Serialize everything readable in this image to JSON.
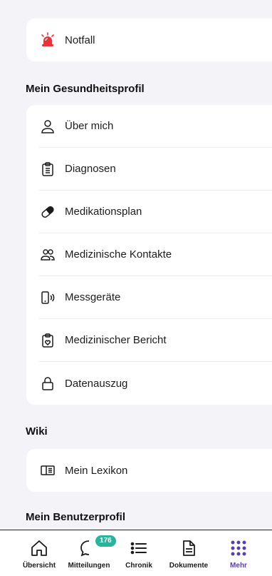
{
  "emergency": {
    "label": "Notfall",
    "icon": "alarm-siren-icon",
    "accent": "#e8333b"
  },
  "health_profile": {
    "title": "Mein Gesundheitsprofil",
    "items": [
      {
        "label": "Über mich",
        "icon": "person-icon"
      },
      {
        "label": "Diagnosen",
        "icon": "clipboard-icon"
      },
      {
        "label": "Medikationsplan",
        "icon": "pill-icon"
      },
      {
        "label": "Medizinische Kontakte",
        "icon": "people-icon"
      },
      {
        "label": "Messgeräte",
        "icon": "device-icon"
      },
      {
        "label": "Medizinischer Bericht",
        "icon": "report-icon"
      },
      {
        "label": "Datenauszug",
        "icon": "lock-icon"
      }
    ]
  },
  "wiki": {
    "title": "Wiki",
    "items": [
      {
        "label": "Mein Lexikon",
        "icon": "book-icon"
      }
    ]
  },
  "user_profile": {
    "title": "Mein Benutzerprofil"
  },
  "tabbar": {
    "active_color": "#5b3fa8",
    "badge_color": "#2bb39b",
    "tabs": [
      {
        "label": "Übersicht",
        "icon": "home-icon"
      },
      {
        "label": "Mitteilungen",
        "icon": "chat-icon",
        "badge": "176"
      },
      {
        "label": "Chronik",
        "icon": "list-icon"
      },
      {
        "label": "Dokumente",
        "icon": "document-icon"
      },
      {
        "label": "Mehr",
        "icon": "grid-dots-icon",
        "active": true
      }
    ]
  }
}
